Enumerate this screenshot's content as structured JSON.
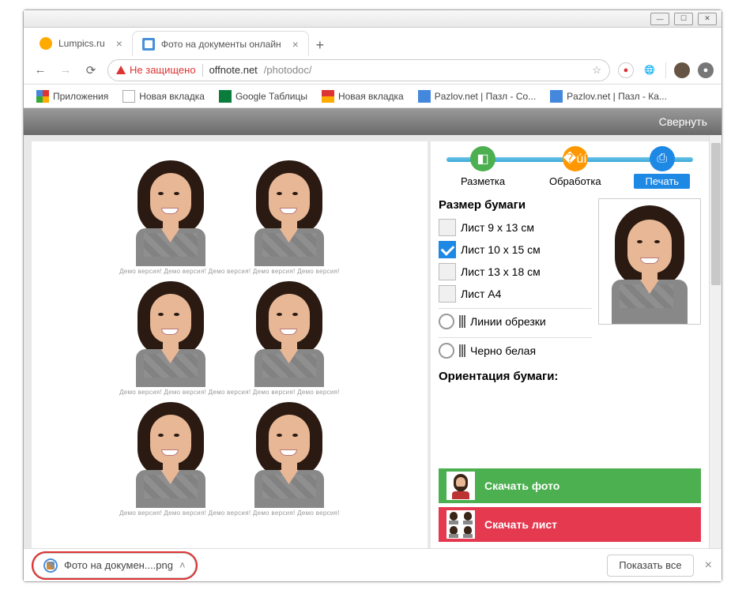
{
  "window": {
    "min": "—",
    "max": "☐",
    "close": "✕"
  },
  "tabs": [
    {
      "title": "Lumpics.ru",
      "favicon": "orange"
    },
    {
      "title": "Фото на документы онлайн",
      "favicon": "app",
      "active": true
    }
  ],
  "addressbar": {
    "security": "Не защищено",
    "url_host": "offnote.net",
    "url_path": "/photodoc/"
  },
  "bookmarks": [
    {
      "label": "Приложения",
      "type": "apps"
    },
    {
      "label": "Новая вкладка",
      "type": "page"
    },
    {
      "label": "Google Таблицы",
      "type": "sheets"
    },
    {
      "label": "Новая вкладка",
      "type": "ya"
    },
    {
      "label": "Pazlov.net | Пазл - Со...",
      "type": "puzzle"
    },
    {
      "label": "Pazlov.net | Пазл - Ка...",
      "type": "puzzle"
    }
  ],
  "app": {
    "title": "Фото на документы",
    "collapse": "Свернуть",
    "watermark": "Демо версия! Демо версия! Демо версия! Демо версия! Демо версия!"
  },
  "steps": [
    {
      "label": "Разметка",
      "color": "#4caf50",
      "icon": "crop"
    },
    {
      "label": "Обработка",
      "color": "#ff9800",
      "icon": "sliders"
    },
    {
      "label": "Печать",
      "color": "#1e88e5",
      "icon": "print",
      "active": true
    }
  ],
  "panel": {
    "paper_header": "Размер бумаги",
    "sizes": [
      {
        "label": "Лист 9 x 13 см",
        "checked": false
      },
      {
        "label": "Лист 10 x 15 см",
        "checked": true
      },
      {
        "label": "Лист 13 x 18 см",
        "checked": false
      },
      {
        "label": "Лист A4",
        "checked": false
      }
    ],
    "cutlines": "Линии обрезки",
    "bw": "Черно белая",
    "orientation": "Ориентация бумаги:"
  },
  "actions": {
    "download_photo": "Скачать фото",
    "download_sheet": "Скачать лист"
  },
  "download": {
    "filename": "Фото на докумен....png",
    "show_all": "Показать все"
  }
}
